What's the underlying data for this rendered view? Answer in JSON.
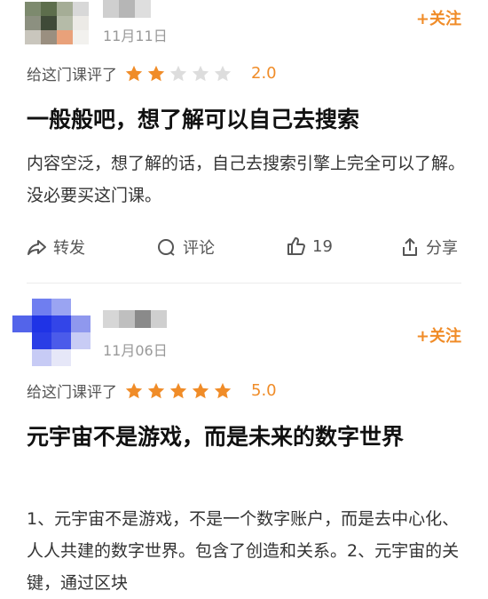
{
  "reviews": [
    {
      "date": "11月11日",
      "follow": "+关注",
      "rating_label": "给这门课评了",
      "stars": 2,
      "score": "2.0",
      "title": "一般般吧，想了解可以自己去搜索",
      "body": "内容空泛，想了解的话，自己去搜索引擎上完全可以了解。没必要买这门课。",
      "actions": {
        "share": "转发",
        "comment": "评论",
        "like": "19",
        "share2": "分享"
      }
    },
    {
      "date": "11月06日",
      "follow": "+关注",
      "rating_label": "给这门课评了",
      "stars": 5,
      "score": "5.0",
      "title": "元宇宙不是游戏，而是未来的数字世界",
      "body": "1、元宇宙不是游戏，不是一个数字账户，而是去中心化、人人共建的数字世界。包含了创造和关系。2、元宇宙的关键，通过区块"
    }
  ],
  "colors": {
    "accent": "#f08c28",
    "star_on": "#f08c28",
    "star_off": "#dddddd"
  },
  "icons": {
    "share": "forward-arrow-icon",
    "comment": "comment-bubble-icon",
    "like": "thumbs-up-icon",
    "share2": "share-upload-icon"
  }
}
